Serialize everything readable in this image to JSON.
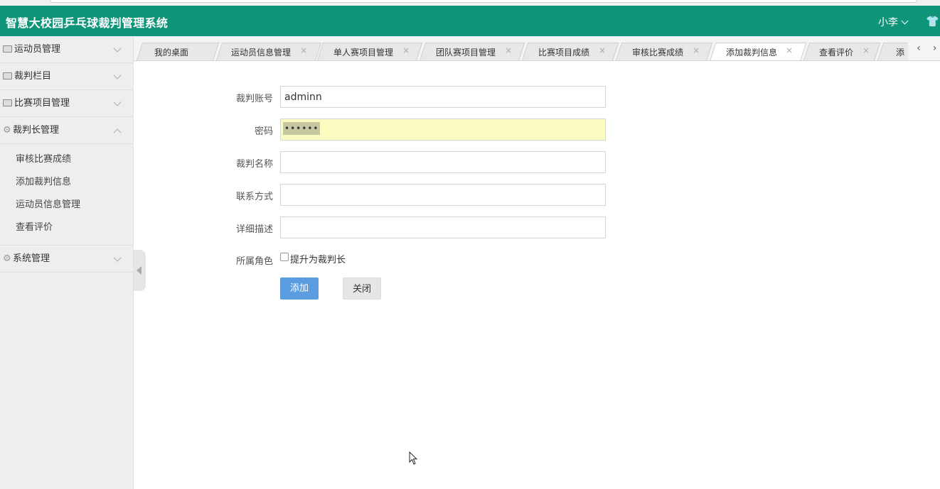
{
  "header": {
    "title": "智慧大校园乒乓球裁判管理系统",
    "user": "小李"
  },
  "sidebar": {
    "items": [
      {
        "label": "运动员管理",
        "icon": "image-icon",
        "expanded": false
      },
      {
        "label": "裁判栏目",
        "icon": "image-icon",
        "expanded": false
      },
      {
        "label": "比赛项目管理",
        "icon": "image-icon",
        "expanded": false
      },
      {
        "label": "裁判长管理",
        "icon": "gear-icon",
        "expanded": true,
        "children": [
          "审核比赛成绩",
          "添加裁判信息",
          "运动员信息管理",
          "查看评价"
        ]
      },
      {
        "label": "系统管理",
        "icon": "gear-icon",
        "expanded": false
      }
    ]
  },
  "tabs": [
    {
      "label": "我的桌面",
      "closable": false
    },
    {
      "label": "运动员信息管理",
      "closable": true
    },
    {
      "label": "单人赛项目管理",
      "closable": true
    },
    {
      "label": "团队赛项目管理",
      "closable": true
    },
    {
      "label": "比赛项目成绩",
      "closable": true
    },
    {
      "label": "审核比赛成绩",
      "closable": true
    },
    {
      "label": "添加裁判信息",
      "closable": true,
      "active": true
    },
    {
      "label": "查看评价",
      "closable": true
    },
    {
      "label": "添",
      "closable": false
    }
  ],
  "tab_close_glyph": "×",
  "tab_nav": {
    "prev": "‹",
    "next": "›"
  },
  "form": {
    "account_label": "裁判账号",
    "account_value": "adminn",
    "password_label": "密码",
    "password_display": "••••••",
    "name_label": "裁判名称",
    "name_value": "",
    "contact_label": "联系方式",
    "contact_value": "",
    "desc_label": "详细描述",
    "desc_value": "",
    "role_label": "所属角色",
    "role_checkbox_label": "提升为裁判长",
    "role_checked": false,
    "submit_label": "添加",
    "close_label": "关闭"
  },
  "colors": {
    "header_bg": "#0e9478",
    "primary_button": "#5b9be0",
    "autofill_bg": "#fafcc0"
  }
}
